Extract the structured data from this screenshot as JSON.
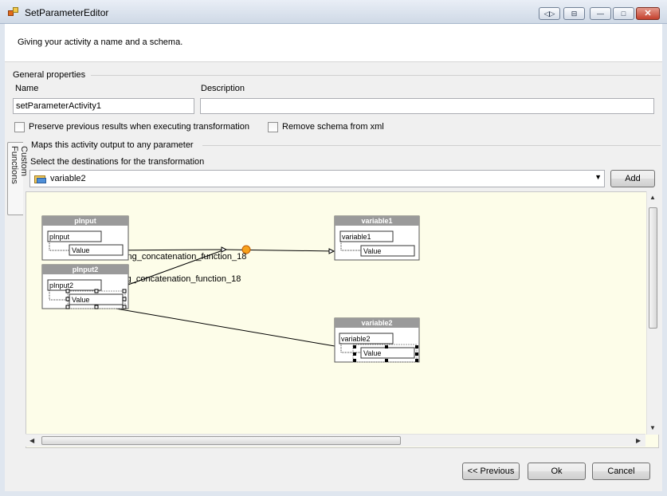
{
  "window": {
    "title": "SetParameterEditor",
    "controls": [
      "◁▷",
      "⊟",
      "—",
      "□",
      "✕"
    ]
  },
  "header": {
    "description": "Giving your activity a name and a schema."
  },
  "general": {
    "group_label": "General properties",
    "name_label": "Name",
    "name_value": "setParameterActivity1",
    "description_label": "Description",
    "description_value": "",
    "preserve_label": "Preserve previous results when executing transformation",
    "preserve_checked": false,
    "remove_schema_label": "Remove schema from xml",
    "remove_schema_checked": false
  },
  "side_tab": {
    "label": "Custom Functions"
  },
  "mapping": {
    "group_label": "Maps this activity output to any parameter",
    "destination_label": "Select the destinations for the transformation",
    "destination_value": "variable2",
    "add_label": "Add"
  },
  "diagram": {
    "nodes": [
      {
        "title": "pInput",
        "root": "pInput",
        "child": "Value",
        "selected": false
      },
      {
        "title": "pInput2",
        "root": "pInput2",
        "child": "Value",
        "selected": true
      },
      {
        "title": "variable1",
        "root": "variable1",
        "child": "Value",
        "selected": false
      },
      {
        "title": "variable2",
        "root": "variable2",
        "child": "Value",
        "selected": true
      }
    ],
    "function_labels": [
      "String_concatenation_function_18",
      "String_concatenation_function_18"
    ],
    "colors": {
      "header": "#9a9a9a",
      "function_node": "#f7a21b",
      "canvas": "#fdfde9"
    }
  },
  "footer": {
    "previous_label": "<< Previous",
    "ok_label": "Ok",
    "cancel_label": "Cancel"
  }
}
